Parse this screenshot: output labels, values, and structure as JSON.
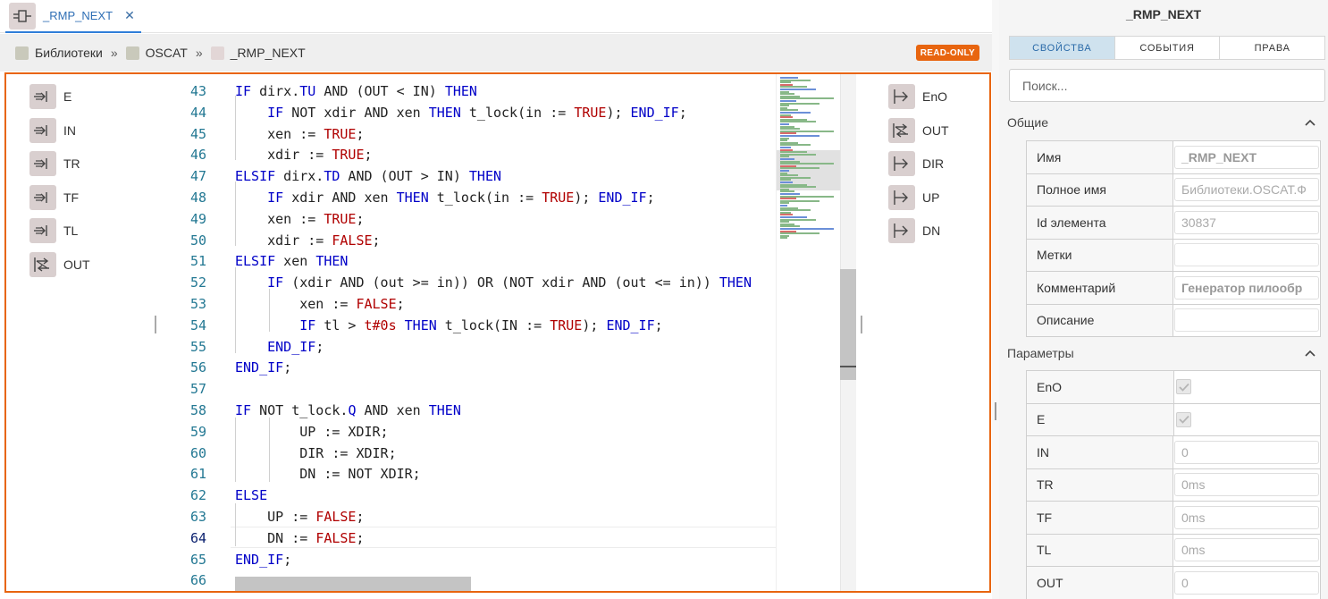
{
  "tab": {
    "title": "_RMP_NEXT",
    "close": "✕",
    "icon": "function-block-icon"
  },
  "breadcrumb": [
    {
      "label": "Библиотеки",
      "color": "#c9c9bb"
    },
    {
      "label": "OSCAT",
      "color": "#c9c9bb"
    },
    {
      "label": "_RMP_NEXT",
      "color": "#e2d6d6"
    }
  ],
  "breadcrumb_sep": "»",
  "readonly_badge": "READ-ONLY",
  "inputs": [
    "E",
    "IN",
    "TR",
    "TF",
    "TL",
    "OUT"
  ],
  "outputs": [
    "EnO",
    "OUT",
    "DIR",
    "UP",
    "DN"
  ],
  "code": {
    "current_line": 64,
    "lines": [
      {
        "n": "43",
        "tokens": [
          [
            "kw",
            "IF"
          ],
          [
            "t",
            " dirx."
          ],
          [
            "kw",
            "TU"
          ],
          [
            "t",
            " AND (OUT < IN) "
          ],
          [
            "kw",
            "THEN"
          ]
        ]
      },
      {
        "n": "44",
        "tokens": [
          [
            "t",
            "    "
          ],
          [
            "kw",
            "IF"
          ],
          [
            "t",
            " NOT xdir AND xen "
          ],
          [
            "kw",
            "THEN"
          ],
          [
            "t",
            " t_lock(in := "
          ],
          [
            "lit",
            "TRUE"
          ],
          [
            "t",
            "); "
          ],
          [
            "kw",
            "END_IF"
          ],
          [
            "t",
            ";"
          ]
        ]
      },
      {
        "n": "45",
        "tokens": [
          [
            "t",
            "    xen := "
          ],
          [
            "lit",
            "TRUE"
          ],
          [
            "t",
            ";"
          ]
        ]
      },
      {
        "n": "46",
        "tokens": [
          [
            "t",
            "    xdir := "
          ],
          [
            "lit",
            "TRUE"
          ],
          [
            "t",
            ";"
          ]
        ]
      },
      {
        "n": "47",
        "tokens": [
          [
            "kw",
            "ELSIF"
          ],
          [
            "t",
            " dirx."
          ],
          [
            "kw",
            "TD"
          ],
          [
            "t",
            " AND (OUT > IN) "
          ],
          [
            "kw",
            "THEN"
          ]
        ]
      },
      {
        "n": "48",
        "tokens": [
          [
            "t",
            "    "
          ],
          [
            "kw",
            "IF"
          ],
          [
            "t",
            " xdir AND xen "
          ],
          [
            "kw",
            "THEN"
          ],
          [
            "t",
            " t_lock(in := "
          ],
          [
            "lit",
            "TRUE"
          ],
          [
            "t",
            "); "
          ],
          [
            "kw",
            "END_IF"
          ],
          [
            "t",
            ";"
          ]
        ]
      },
      {
        "n": "49",
        "tokens": [
          [
            "t",
            "    xen := "
          ],
          [
            "lit",
            "TRUE"
          ],
          [
            "t",
            ";"
          ]
        ]
      },
      {
        "n": "50",
        "tokens": [
          [
            "t",
            "    xdir := "
          ],
          [
            "lit",
            "FALSE"
          ],
          [
            "t",
            ";"
          ]
        ]
      },
      {
        "n": "51",
        "tokens": [
          [
            "kw",
            "ELSIF"
          ],
          [
            "t",
            " xen "
          ],
          [
            "kw",
            "THEN"
          ]
        ]
      },
      {
        "n": "52",
        "tokens": [
          [
            "t",
            "    "
          ],
          [
            "kw",
            "IF"
          ],
          [
            "t",
            " (xdir AND (out >= in)) OR (NOT xdir AND (out <= in)) "
          ],
          [
            "kw",
            "THEN"
          ]
        ]
      },
      {
        "n": "53",
        "tokens": [
          [
            "t",
            "        xen := "
          ],
          [
            "lit",
            "FALSE"
          ],
          [
            "t",
            ";"
          ]
        ]
      },
      {
        "n": "54",
        "tokens": [
          [
            "t",
            "        "
          ],
          [
            "kw",
            "IF"
          ],
          [
            "t",
            " tl > "
          ],
          [
            "lit",
            "t#0s"
          ],
          [
            "t",
            " "
          ],
          [
            "kw",
            "THEN"
          ],
          [
            "t",
            " t_lock(IN := "
          ],
          [
            "lit",
            "TRUE"
          ],
          [
            "t",
            "); "
          ],
          [
            "kw",
            "END_IF"
          ],
          [
            "t",
            ";"
          ]
        ]
      },
      {
        "n": "55",
        "tokens": [
          [
            "t",
            "    "
          ],
          [
            "kw",
            "END_IF"
          ],
          [
            "t",
            ";"
          ]
        ]
      },
      {
        "n": "56",
        "tokens": [
          [
            "kw",
            "END_IF"
          ],
          [
            "t",
            ";"
          ]
        ]
      },
      {
        "n": "57",
        "tokens": []
      },
      {
        "n": "58",
        "tokens": [
          [
            "kw",
            "IF"
          ],
          [
            "t",
            " NOT t_lock."
          ],
          [
            "kw",
            "Q"
          ],
          [
            "t",
            " AND xen "
          ],
          [
            "kw",
            "THEN"
          ]
        ]
      },
      {
        "n": "59",
        "tokens": [
          [
            "t",
            "        UP := XDIR;"
          ]
        ]
      },
      {
        "n": "60",
        "tokens": [
          [
            "t",
            "        DIR := XDIR;"
          ]
        ]
      },
      {
        "n": "61",
        "tokens": [
          [
            "t",
            "        DN := NOT XDIR;"
          ]
        ]
      },
      {
        "n": "62",
        "tokens": [
          [
            "kw",
            "ELSE"
          ]
        ]
      },
      {
        "n": "63",
        "tokens": [
          [
            "t",
            "    UP := "
          ],
          [
            "lit",
            "FALSE"
          ],
          [
            "t",
            ";"
          ]
        ]
      },
      {
        "n": "64",
        "tokens": [
          [
            "t",
            "    DN := "
          ],
          [
            "lit",
            "FALSE"
          ],
          [
            "t",
            ";"
          ]
        ]
      },
      {
        "n": "65",
        "tokens": [
          [
            "kw",
            "END_IF"
          ],
          [
            "t",
            ";"
          ]
        ]
      },
      {
        "n": "66",
        "tokens": []
      }
    ]
  },
  "panel": {
    "title": "_RMP_NEXT",
    "tabs": [
      {
        "label": "СВОЙСТВА",
        "active": true
      },
      {
        "label": "СОБЫТИЯ",
        "active": false
      },
      {
        "label": "ПРАВА",
        "active": false
      }
    ],
    "search_placeholder": "Поиск...",
    "general": {
      "title": "Общие",
      "rows": [
        {
          "name": "Имя",
          "value": "_RMP_NEXT",
          "style": "bold"
        },
        {
          "name": "Полное имя",
          "value": "Библиотеки.OSCAT.Ф",
          "style": ""
        },
        {
          "name": "Id элемента",
          "value": "30837",
          "style": ""
        },
        {
          "name": "Метки",
          "value": "",
          "style": "empty"
        },
        {
          "name": "Комментарий",
          "value": "Генератор пилообр",
          "style": "bold"
        },
        {
          "name": "Описание",
          "value": "",
          "style": "empty"
        }
      ]
    },
    "params": {
      "title": "Параметры",
      "rows": [
        {
          "name": "EnO",
          "type": "check",
          "value": ""
        },
        {
          "name": "E",
          "type": "check",
          "value": ""
        },
        {
          "name": "IN",
          "type": "text",
          "value": "0"
        },
        {
          "name": "TR",
          "type": "text",
          "value": "0ms"
        },
        {
          "name": "TF",
          "type": "text",
          "value": "0ms"
        },
        {
          "name": "TL",
          "type": "text",
          "value": "0ms"
        },
        {
          "name": "OUT",
          "type": "text",
          "value": "0"
        }
      ]
    }
  }
}
